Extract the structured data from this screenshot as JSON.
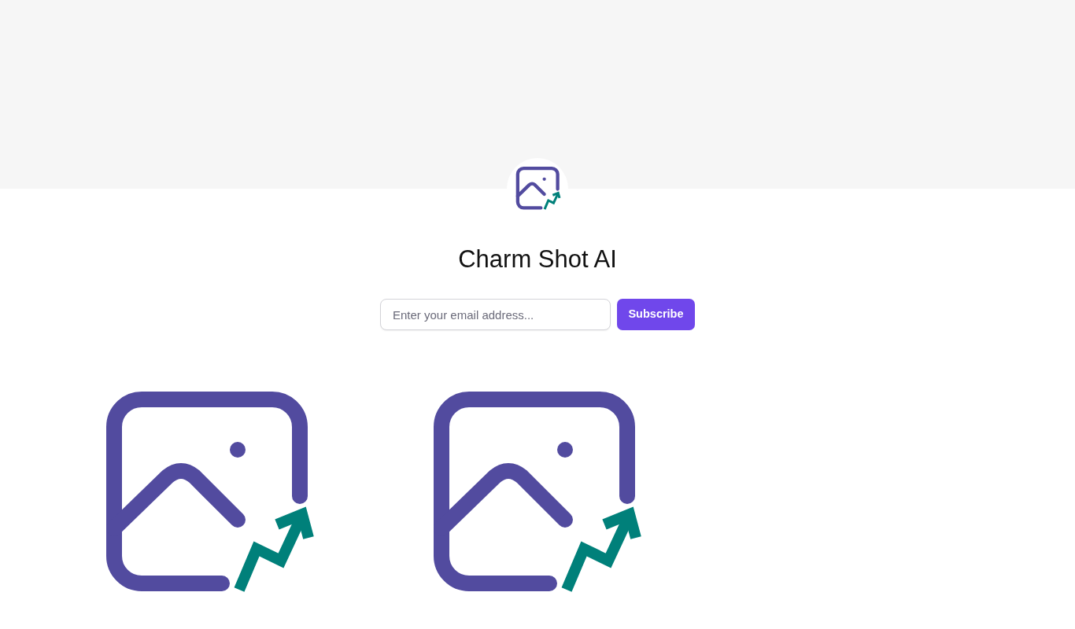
{
  "site": {
    "title": "Charm Shot AI"
  },
  "subscribe_form": {
    "placeholder": "Enter your email address...",
    "button": "Subscribe"
  },
  "posts": [
    {
      "kind": "logo"
    },
    {
      "kind": "logo"
    }
  ]
}
